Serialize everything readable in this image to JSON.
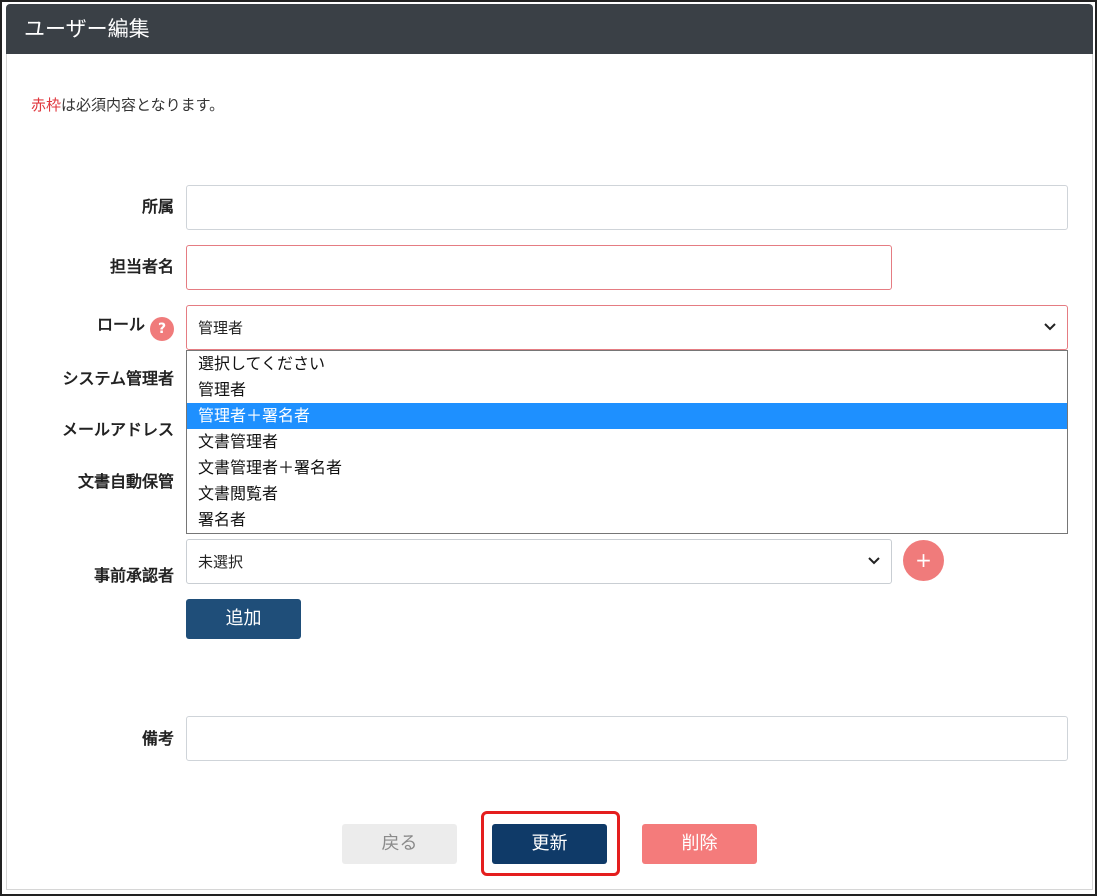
{
  "header": {
    "title": "ユーザー編集"
  },
  "notice": {
    "red_text": "赤枠",
    "rest_text": "は必須内容となります。"
  },
  "form": {
    "affiliation": {
      "label": "所属",
      "value": ""
    },
    "person_name": {
      "label": "担当者名",
      "value": ""
    },
    "role": {
      "label": "ロール",
      "help_glyph": "?",
      "selected": "管理者",
      "options": [
        "選択してください",
        "管理者",
        "管理者＋署名者",
        "文書管理者",
        "文書管理者＋署名者",
        "文書閲覧者",
        "署名者"
      ],
      "highlighted_option": "管理者＋署名者"
    },
    "system_admin": {
      "label": "システム管理者"
    },
    "email": {
      "label": "メールアドレス"
    },
    "auto_save": {
      "label": "文書自動保管"
    },
    "approver": {
      "label": "事前承認者",
      "selected": "未選択",
      "add_glyph": "+"
    },
    "add_button": "追加",
    "remarks": {
      "label": "備考",
      "value": ""
    }
  },
  "actions": {
    "back": "戻る",
    "update": "更新",
    "delete": "削除"
  },
  "icons": {
    "help": "question-circle-icon",
    "chevron": "chevron-down-icon",
    "plus": "plus-circle-icon"
  },
  "colors": {
    "header_bg": "#3a4046",
    "required_border": "#e57c82",
    "accent_red": "#f07b7b",
    "primary": "#1f4e79",
    "highlight": "#e41e1e"
  }
}
